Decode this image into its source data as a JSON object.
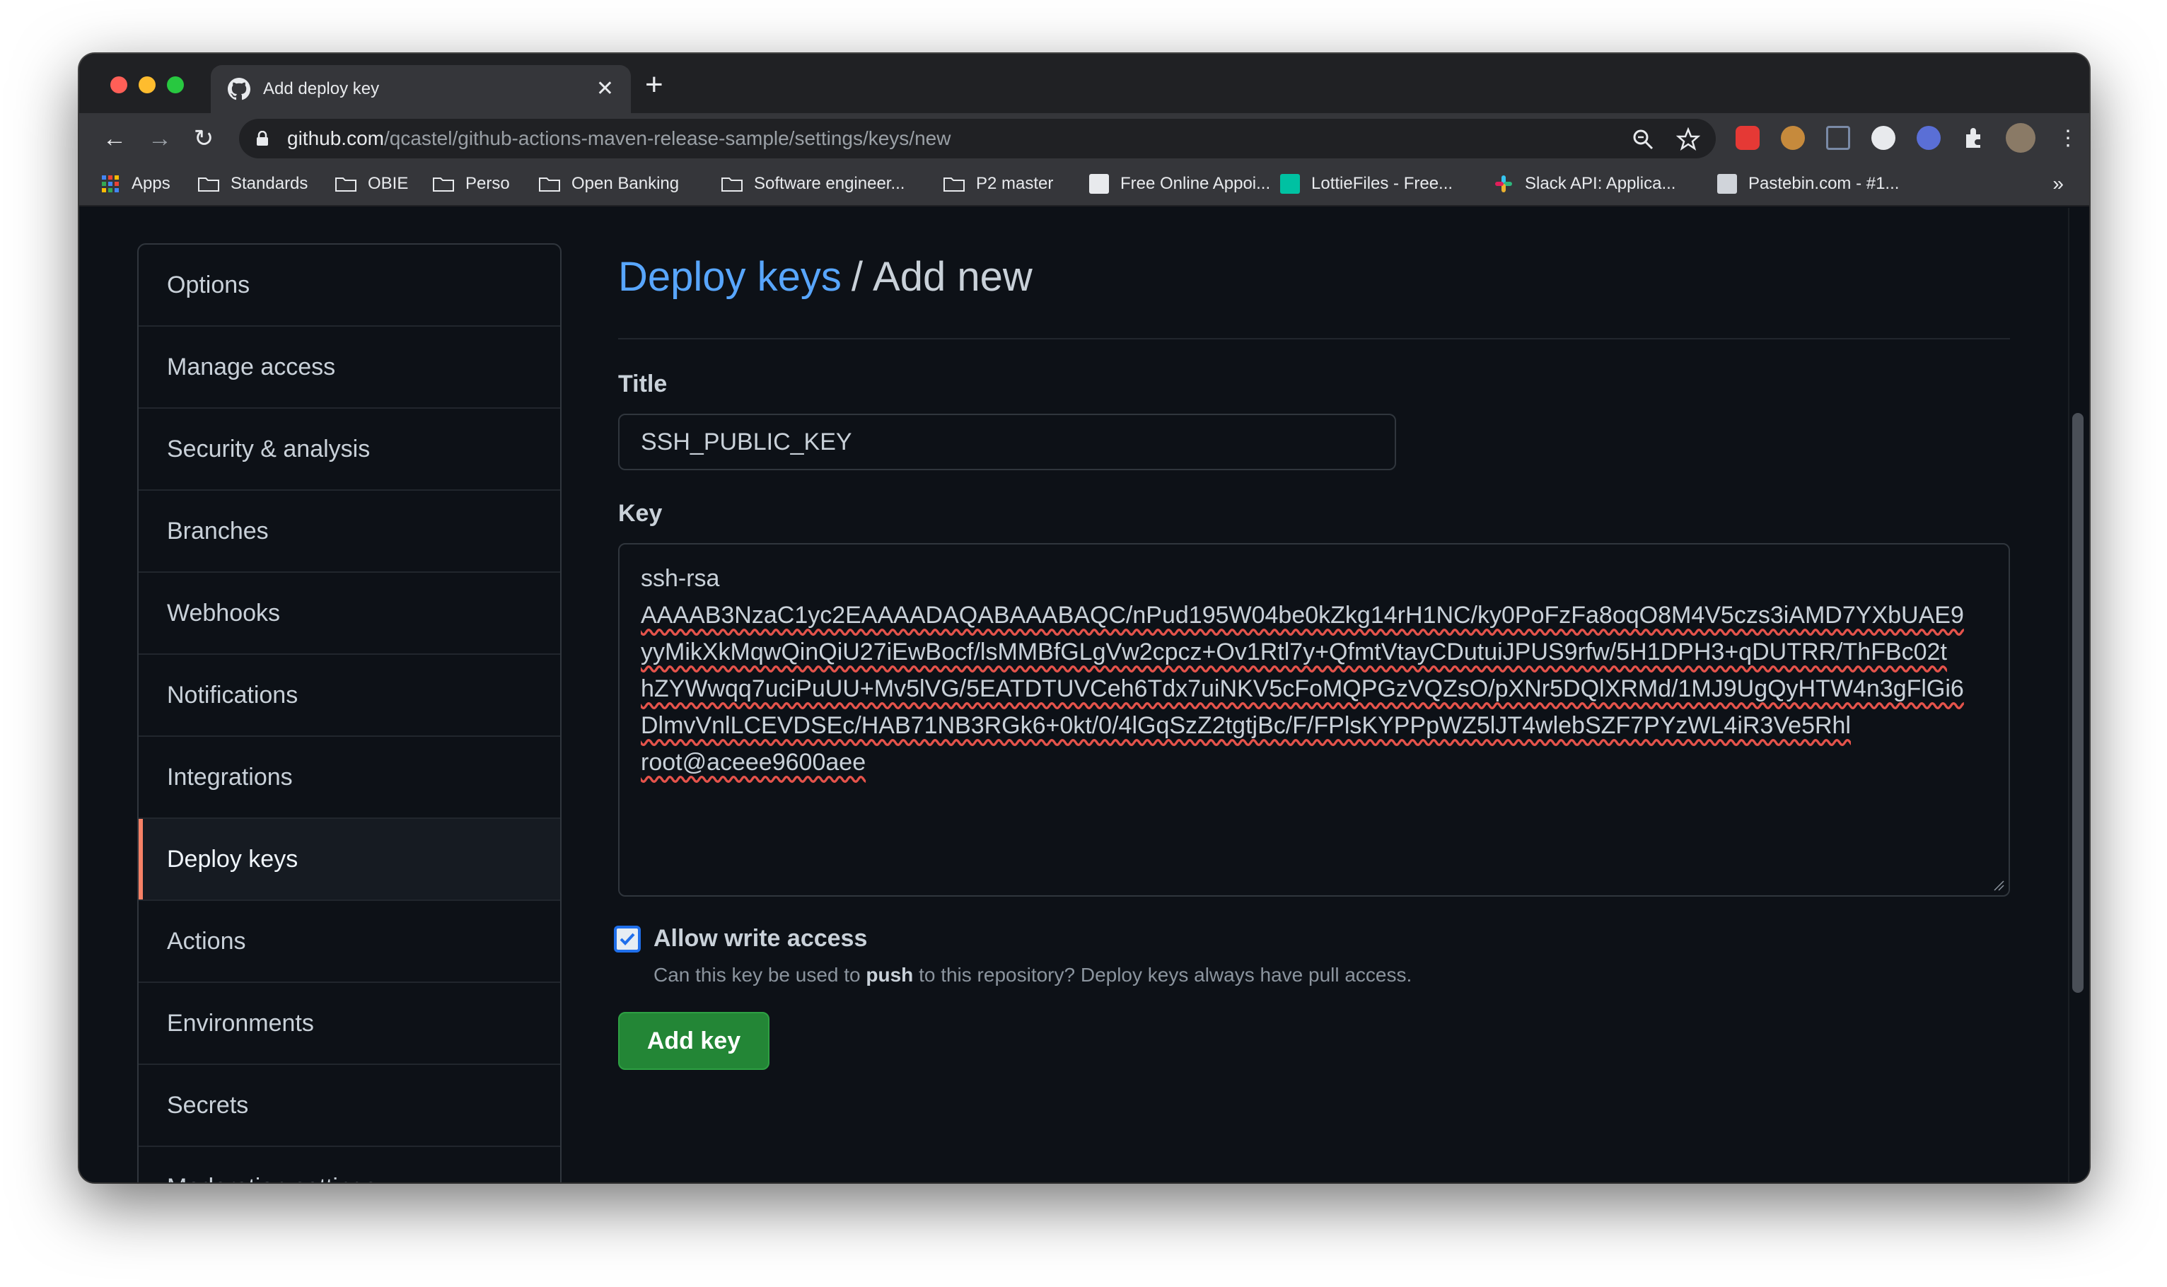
{
  "browser": {
    "tab_title": "Add deploy key",
    "new_tab": "+",
    "close": "✕",
    "url_host": "github.com",
    "url_path": "/qcastel/github-actions-maven-release-sample/settings/keys/new"
  },
  "bookmarks": [
    {
      "label": "Apps",
      "icon": "apps-grid-icon"
    },
    {
      "label": "Standards",
      "icon": "folder-icon"
    },
    {
      "label": "OBIE",
      "icon": "folder-icon"
    },
    {
      "label": "Perso",
      "icon": "folder-icon"
    },
    {
      "label": "Open Banking",
      "icon": "folder-icon"
    },
    {
      "label": "Software engineer...",
      "icon": "folder-icon"
    },
    {
      "label": "P2 master",
      "icon": "folder-icon"
    },
    {
      "label": "Free Online Appoi...",
      "icon": "calendar-favicon"
    },
    {
      "label": "LottieFiles - Free...",
      "icon": "lottiefiles-favicon"
    },
    {
      "label": "Slack API: Applica...",
      "icon": "slack-favicon"
    },
    {
      "label": "Pastebin.com - #1...",
      "icon": "pastebin-favicon"
    }
  ],
  "bookmarks_more": "»",
  "sidebar": {
    "items": [
      {
        "label": "Options"
      },
      {
        "label": "Manage access"
      },
      {
        "label": "Security & analysis"
      },
      {
        "label": "Branches"
      },
      {
        "label": "Webhooks"
      },
      {
        "label": "Notifications"
      },
      {
        "label": "Integrations"
      },
      {
        "label": "Deploy keys",
        "selected": true
      },
      {
        "label": "Actions"
      },
      {
        "label": "Environments"
      },
      {
        "label": "Secrets"
      },
      {
        "label": "Moderation settings"
      }
    ]
  },
  "main": {
    "heading_link": "Deploy keys",
    "heading_sep": "/",
    "heading_rest": "Add new",
    "title_label": "Title",
    "title_value": "SSH_PUBLIC_KEY",
    "key_label": "Key",
    "key_lines": [
      "ssh-rsa",
      "AAAAB3NzaC1yc2EAAAADAQABAAABAQC/nPud195W04be0kZkg14rH1NC/ky0PoFzFa8oqO8M4V5czs3iAMD7YXbUAE9",
      "yyMikXkMqwQinQiU27iEwBocf/lsMMBfGLgVw2cpcz+Ov1Rtl7y+QfmtVtayCDutuiJPUS9rfw/5H1DPH3+qDUTRR/ThFBc02t",
      "hZYWwqq7uciPuUU+Mv5lVG/5EATDTUVCeh6Tdx7uiNKV5cFoMQPGzVQZsO/pXNr5DQlXRMd/1MJ9UgQyHTW4n3gFlGi6",
      "DlmvVnlLCEVDSEc/HAB71NB3RGk6+0kt/0/4lGqSzZ2tgtjBc/F/FPlsKYPPpWZ5lJT4wlebSZF7PYzWL4iR3Ve5Rhl",
      "root@aceee9600aee"
    ],
    "allow_write_label": "Allow write access",
    "help_prefix": "Can this key be used to ",
    "help_bold": "push",
    "help_suffix": " to this repository? Deploy keys always have pull access.",
    "add_button": "Add key"
  },
  "colors": {
    "link": "#58a6ff",
    "accent_selected": "#f78166",
    "button_green": "#238636",
    "background": "#0d1117"
  }
}
